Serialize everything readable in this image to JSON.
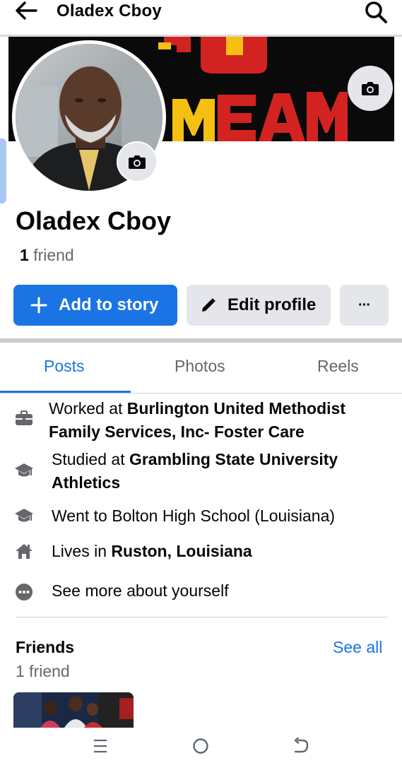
{
  "header": {
    "title": "Oladex Cboy",
    "back_icon": "arrow-left-icon",
    "search_icon": "search-icon"
  },
  "cover": {
    "text": "MEAM",
    "colors": {
      "background": "#0a0a0a",
      "red": "#d32321",
      "gold": "#f5c012"
    }
  },
  "profile": {
    "name": "Oladex Cboy",
    "friend_count": "1",
    "friend_word": "friend"
  },
  "actions": {
    "add_story": "Add to story",
    "edit_profile": "Edit profile",
    "more": "···"
  },
  "tabs": [
    {
      "label": "Posts",
      "active": true
    },
    {
      "label": "Photos",
      "active": false
    },
    {
      "label": "Reels",
      "active": false
    }
  ],
  "about": {
    "work": {
      "prefix": "Worked at ",
      "place": "Burlington United Methodist Family Services, Inc- Foster Care",
      "icon": "briefcase-icon"
    },
    "study": {
      "prefix": "Studied at ",
      "place": "Grambling State University Athletics",
      "icon": "graduation-cap-icon"
    },
    "school": {
      "text": "Went to Bolton High School (Louisiana)",
      "icon": "graduation-cap-icon"
    },
    "lives": {
      "prefix": "Lives in ",
      "place": "Ruston, Louisiana",
      "icon": "home-icon"
    },
    "see_more": {
      "text": "See more about yourself",
      "icon": "more-icon"
    }
  },
  "friends": {
    "title": "Friends",
    "see_all": "See all",
    "count_text": "1 friend"
  },
  "colors": {
    "accent": "#1b74e4",
    "secondary_button": "#e4e6eb",
    "muted_text": "#65676b"
  }
}
